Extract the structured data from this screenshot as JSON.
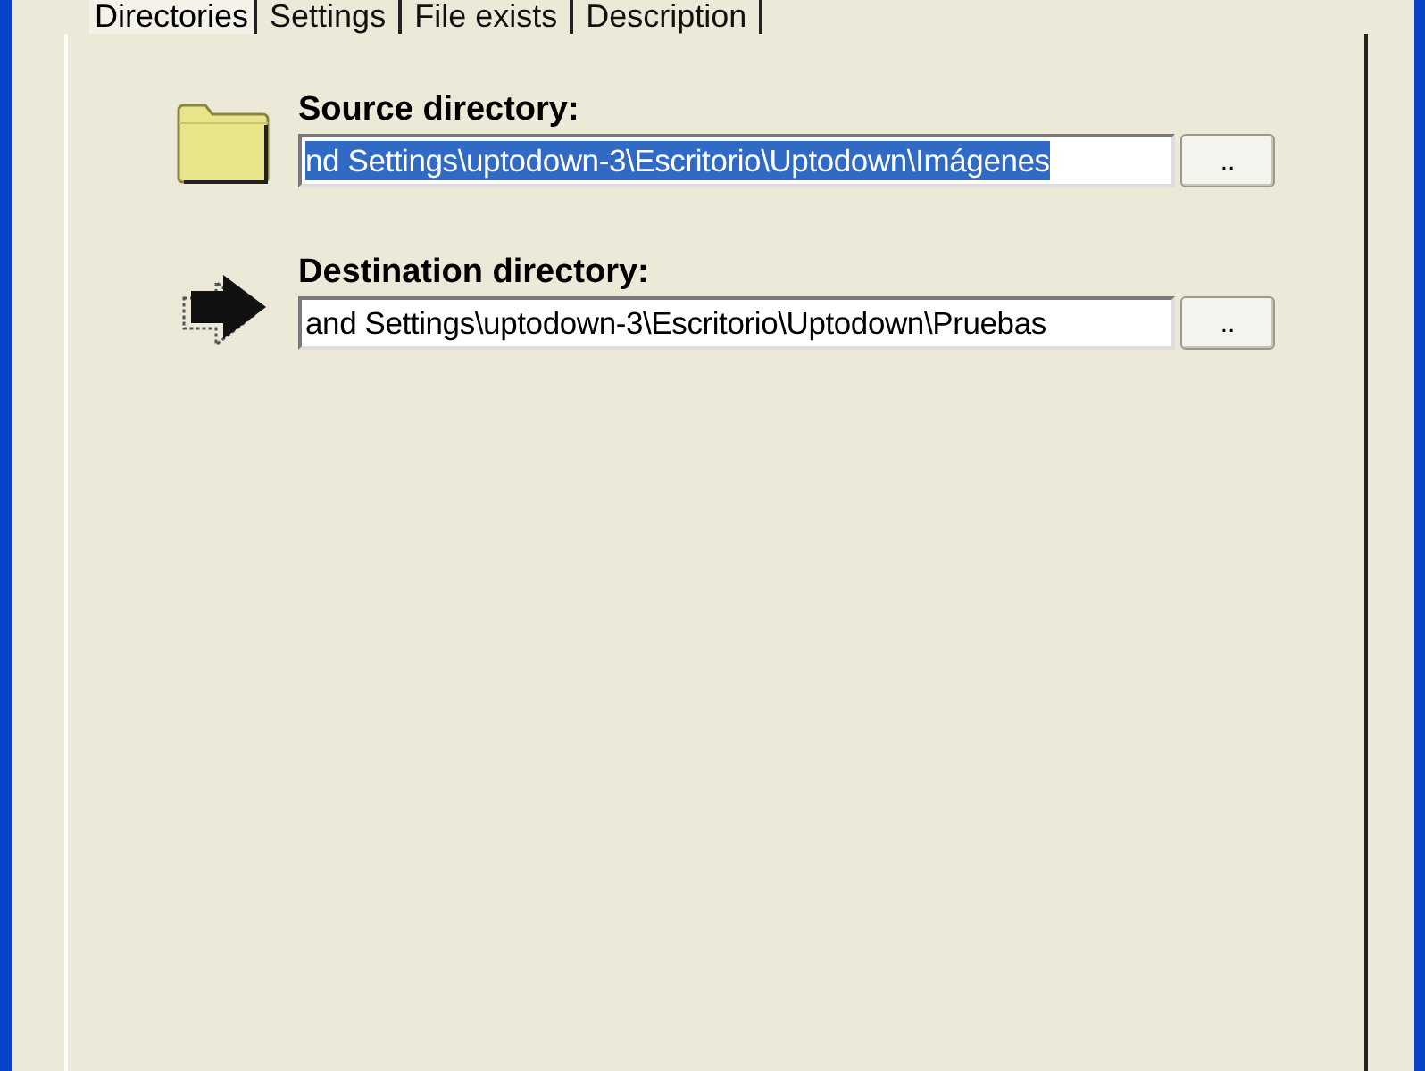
{
  "tabs": [
    {
      "label": "Directories",
      "selected": true
    },
    {
      "label": "Settings",
      "selected": false
    },
    {
      "label": "File exists",
      "selected": false
    },
    {
      "label": "Description",
      "selected": false
    }
  ],
  "directories": [
    {
      "kind": "folder",
      "label": "Source directory:",
      "value": "nd Settings\\uptodown-3\\Escritorio\\Uptodown\\Imágenes",
      "text_selected": true,
      "button": ".."
    },
    {
      "kind": "arrow",
      "label": "Destination directory:",
      "value": "and Settings\\uptodown-3\\Escritorio\\Uptodown\\Pruebas",
      "text_selected": false,
      "button": ".."
    }
  ]
}
